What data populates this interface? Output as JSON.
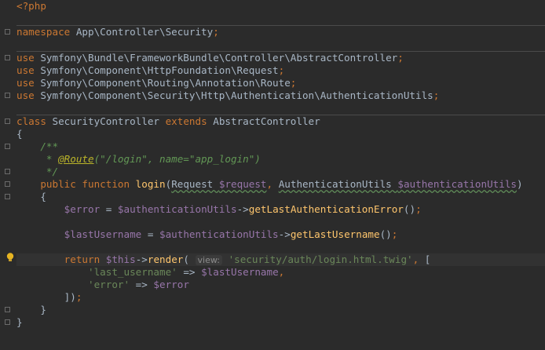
{
  "lines": [
    {
      "tokens": [
        {
          "t": "<?php",
          "c": "k"
        }
      ]
    },
    {
      "tokens": []
    },
    {
      "sep": true,
      "tokens": [
        {
          "t": "namespace",
          "c": "k"
        },
        {
          "t": " App\\Controller\\Security"
        },
        {
          "t": ";",
          "c": "k"
        }
      ]
    },
    {
      "tokens": []
    },
    {
      "sep": true,
      "tokens": [
        {
          "t": "use",
          "c": "k"
        },
        {
          "t": " Symfony\\Bundle\\FrameworkBundle\\Controller\\AbstractController"
        },
        {
          "t": ";",
          "c": "k"
        }
      ]
    },
    {
      "tokens": [
        {
          "t": "use",
          "c": "k"
        },
        {
          "t": " Symfony\\Component\\HttpFoundation\\Request"
        },
        {
          "t": ";",
          "c": "k"
        }
      ]
    },
    {
      "tokens": [
        {
          "t": "use",
          "c": "k"
        },
        {
          "t": " Symfony\\Component\\Routing\\Annotation\\Route"
        },
        {
          "t": ";",
          "c": "k"
        }
      ]
    },
    {
      "tokens": [
        {
          "t": "use",
          "c": "k"
        },
        {
          "t": " Symfony\\Component\\Security\\Http\\Authentication\\AuthenticationUtils"
        },
        {
          "t": ";",
          "c": "k"
        }
      ]
    },
    {
      "tokens": []
    },
    {
      "sep": true,
      "tokens": [
        {
          "t": "class",
          "c": "k"
        },
        {
          "t": " SecurityController "
        },
        {
          "t": "extends",
          "c": "k"
        },
        {
          "t": " AbstractController"
        }
      ]
    },
    {
      "tokens": [
        {
          "t": "{"
        }
      ]
    },
    {
      "tokens": [
        {
          "t": "    /**",
          "c": "c"
        }
      ]
    },
    {
      "tokens": [
        {
          "t": "     * ",
          "c": "c"
        },
        {
          "t": "@Route",
          "c": "a"
        },
        {
          "t": "(\"/login\", name=\"app_login\")",
          "c": "c"
        }
      ]
    },
    {
      "tokens": [
        {
          "t": "     */",
          "c": "c"
        }
      ]
    },
    {
      "tokens": [
        {
          "t": "    "
        },
        {
          "t": "public function",
          "c": "k"
        },
        {
          "t": " "
        },
        {
          "t": "login",
          "c": "f"
        },
        {
          "t": "("
        },
        {
          "t": "Request ",
          "u": true
        },
        {
          "t": "$request",
          "c": "v",
          "u": true
        },
        {
          "t": ", ",
          "c": "k"
        },
        {
          "t": "AuthenticationUtils ",
          "u": true
        },
        {
          "t": "$authenticationUtils",
          "c": "v",
          "u": true
        },
        {
          "t": ")"
        }
      ]
    },
    {
      "tokens": [
        {
          "t": "    {"
        }
      ]
    },
    {
      "tokens": [
        {
          "t": "        "
        },
        {
          "t": "$error",
          "c": "v"
        },
        {
          "t": " = "
        },
        {
          "t": "$authenticationUtils",
          "c": "v"
        },
        {
          "t": "->"
        },
        {
          "t": "getLastAuthenticationError",
          "c": "f"
        },
        {
          "t": "()"
        },
        {
          "t": ";",
          "c": "k"
        }
      ]
    },
    {
      "tokens": []
    },
    {
      "tokens": [
        {
          "t": "        "
        },
        {
          "t": "$lastUsername",
          "c": "v"
        },
        {
          "t": " = "
        },
        {
          "t": "$authenticationUtils",
          "c": "v"
        },
        {
          "t": "->"
        },
        {
          "t": "getLastUsername",
          "c": "f"
        },
        {
          "t": "()"
        },
        {
          "t": ";",
          "c": "k"
        }
      ]
    },
    {
      "tokens": []
    },
    {
      "hl": true,
      "bulb": true,
      "tokens": [
        {
          "t": "        "
        },
        {
          "t": "return",
          "c": "k"
        },
        {
          "t": " "
        },
        {
          "t": "$this",
          "c": "v"
        },
        {
          "t": "->"
        },
        {
          "t": "render",
          "c": "f"
        },
        {
          "t": "( "
        },
        {
          "t": "view:",
          "c": "hint"
        },
        {
          "t": " "
        },
        {
          "t": "'security/auth/login.html.twig'",
          "c": "s"
        },
        {
          "t": ", ",
          "c": "k"
        },
        {
          "t": "["
        }
      ]
    },
    {
      "tokens": [
        {
          "t": "            "
        },
        {
          "t": "'last_username'",
          "c": "s"
        },
        {
          "t": " => "
        },
        {
          "t": "$lastUsername",
          "c": "v"
        },
        {
          "t": ",",
          "c": "k"
        }
      ]
    },
    {
      "tokens": [
        {
          "t": "            "
        },
        {
          "t": "'error'",
          "c": "s"
        },
        {
          "t": " => "
        },
        {
          "t": "$error",
          "c": "v"
        }
      ]
    },
    {
      "tokens": [
        {
          "t": "        ])"
        },
        {
          "t": ";",
          "c": "k"
        }
      ]
    },
    {
      "tokens": [
        {
          "t": "    }"
        }
      ]
    },
    {
      "tokens": [
        {
          "t": "}"
        }
      ]
    },
    {
      "tokens": []
    }
  ]
}
